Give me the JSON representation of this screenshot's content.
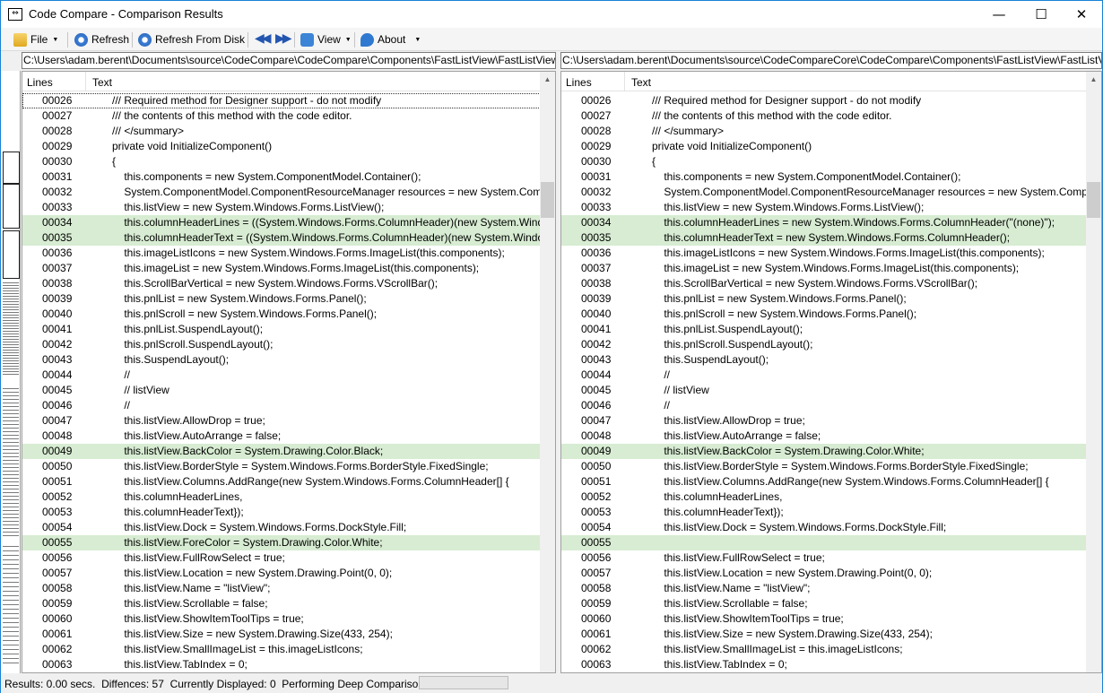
{
  "window": {
    "title": "Code Compare - Comparison Results"
  },
  "toolbar": {
    "file": "File",
    "refresh": "Refresh",
    "refresh_disk": "Refresh From Disk",
    "view": "View",
    "about": "About"
  },
  "left": {
    "path": "C:\\Users\\adam.berent\\Documents\\source\\CodeCompare\\CodeCompare\\Components\\FastListView\\FastListView.Designer.cs",
    "col_lines": "Lines",
    "col_text": "Text",
    "rows": [
      {
        "n": "00026",
        "t": "/// Required method for Designer support - do not modify",
        "d": 0
      },
      {
        "n": "00027",
        "t": "/// the contents of this method with the code editor.",
        "d": 0
      },
      {
        "n": "00028",
        "t": "/// </summary>",
        "d": 0
      },
      {
        "n": "00029",
        "t": "private void InitializeComponent()",
        "d": 0
      },
      {
        "n": "00030",
        "t": "{",
        "d": 0
      },
      {
        "n": "00031",
        "t": "    this.components = new System.ComponentModel.Container();",
        "d": 0
      },
      {
        "n": "00032",
        "t": "    System.ComponentModel.ComponentResourceManager resources = new System.ComponentModel.ComponentResourceManager(typeof(FastListView));",
        "d": 0
      },
      {
        "n": "00033",
        "t": "    this.listView = new System.Windows.Forms.ListView();",
        "d": 0
      },
      {
        "n": "00034",
        "t": "    this.columnHeaderLines = ((System.Windows.Forms.ColumnHeader)(new System.Windows.Forms.ColumnHeader()));",
        "d": 1
      },
      {
        "n": "00035",
        "t": "    this.columnHeaderText = ((System.Windows.Forms.ColumnHeader)(new System.Windows.Forms.ColumnHeader()));",
        "d": 1
      },
      {
        "n": "00036",
        "t": "    this.imageListIcons = new System.Windows.Forms.ImageList(this.components);",
        "d": 0
      },
      {
        "n": "00037",
        "t": "    this.imageList = new System.Windows.Forms.ImageList(this.components);",
        "d": 0
      },
      {
        "n": "00038",
        "t": "    this.ScrollBarVertical = new System.Windows.Forms.VScrollBar();",
        "d": 0
      },
      {
        "n": "00039",
        "t": "    this.pnlList = new System.Windows.Forms.Panel();",
        "d": 0
      },
      {
        "n": "00040",
        "t": "    this.pnlScroll = new System.Windows.Forms.Panel();",
        "d": 0
      },
      {
        "n": "00041",
        "t": "    this.pnlList.SuspendLayout();",
        "d": 0
      },
      {
        "n": "00042",
        "t": "    this.pnlScroll.SuspendLayout();",
        "d": 0
      },
      {
        "n": "00043",
        "t": "    this.SuspendLayout();",
        "d": 0
      },
      {
        "n": "00044",
        "t": "    //",
        "d": 0
      },
      {
        "n": "00045",
        "t": "    // listView",
        "d": 0
      },
      {
        "n": "00046",
        "t": "    //",
        "d": 0
      },
      {
        "n": "00047",
        "t": "    this.listView.AllowDrop = true;",
        "d": 0
      },
      {
        "n": "00048",
        "t": "    this.listView.AutoArrange = false;",
        "d": 0
      },
      {
        "n": "00049",
        "t": "    this.listView.BackColor = System.Drawing.Color.Black;",
        "d": 1
      },
      {
        "n": "00050",
        "t": "    this.listView.BorderStyle = System.Windows.Forms.BorderStyle.FixedSingle;",
        "d": 0
      },
      {
        "n": "00051",
        "t": "    this.listView.Columns.AddRange(new System.Windows.Forms.ColumnHeader[] {",
        "d": 0
      },
      {
        "n": "00052",
        "t": "    this.columnHeaderLines,",
        "d": 0
      },
      {
        "n": "00053",
        "t": "    this.columnHeaderText});",
        "d": 0
      },
      {
        "n": "00054",
        "t": "    this.listView.Dock = System.Windows.Forms.DockStyle.Fill;",
        "d": 0
      },
      {
        "n": "00055",
        "t": "    this.listView.ForeColor = System.Drawing.Color.White;",
        "d": 1
      },
      {
        "n": "00056",
        "t": "    this.listView.FullRowSelect = true;",
        "d": 0
      },
      {
        "n": "00057",
        "t": "    this.listView.Location = new System.Drawing.Point(0, 0);",
        "d": 0
      },
      {
        "n": "00058",
        "t": "    this.listView.Name = \"listView\";",
        "d": 0
      },
      {
        "n": "00059",
        "t": "    this.listView.Scrollable = false;",
        "d": 0
      },
      {
        "n": "00060",
        "t": "    this.listView.ShowItemToolTips = true;",
        "d": 0
      },
      {
        "n": "00061",
        "t": "    this.listView.Size = new System.Drawing.Size(433, 254);",
        "d": 0
      },
      {
        "n": "00062",
        "t": "    this.listView.SmallImageList = this.imageListIcons;",
        "d": 0
      },
      {
        "n": "00063",
        "t": "    this.listView.TabIndex = 0;",
        "d": 0
      }
    ]
  },
  "right": {
    "path": "C:\\Users\\adam.berent\\Documents\\source\\CodeCompareCore\\CodeCompare\\Components\\FastListView\\FastListView.Designer.cs",
    "col_lines": "Lines",
    "col_text": "Text",
    "rows": [
      {
        "n": "00026",
        "t": "/// Required method for Designer support - do not modify",
        "d": 0
      },
      {
        "n": "00027",
        "t": "/// the contents of this method with the code editor.",
        "d": 0
      },
      {
        "n": "00028",
        "t": "/// </summary>",
        "d": 0
      },
      {
        "n": "00029",
        "t": "private void InitializeComponent()",
        "d": 0
      },
      {
        "n": "00030",
        "t": "{",
        "d": 0
      },
      {
        "n": "00031",
        "t": "    this.components = new System.ComponentModel.Container();",
        "d": 0
      },
      {
        "n": "00032",
        "t": "    System.ComponentModel.ComponentResourceManager resources = new System.ComponentModel.ComponentResourceManager(typeof(FastListView));",
        "d": 0
      },
      {
        "n": "00033",
        "t": "    this.listView = new System.Windows.Forms.ListView();",
        "d": 0
      },
      {
        "n": "00034",
        "t": "    this.columnHeaderLines = new System.Windows.Forms.ColumnHeader(\"(none)\");",
        "d": 1
      },
      {
        "n": "00035",
        "t": "    this.columnHeaderText = new System.Windows.Forms.ColumnHeader();",
        "d": 1
      },
      {
        "n": "00036",
        "t": "    this.imageListIcons = new System.Windows.Forms.ImageList(this.components);",
        "d": 0
      },
      {
        "n": "00037",
        "t": "    this.imageList = new System.Windows.Forms.ImageList(this.components);",
        "d": 0
      },
      {
        "n": "00038",
        "t": "    this.ScrollBarVertical = new System.Windows.Forms.VScrollBar();",
        "d": 0
      },
      {
        "n": "00039",
        "t": "    this.pnlList = new System.Windows.Forms.Panel();",
        "d": 0
      },
      {
        "n": "00040",
        "t": "    this.pnlScroll = new System.Windows.Forms.Panel();",
        "d": 0
      },
      {
        "n": "00041",
        "t": "    this.pnlList.SuspendLayout();",
        "d": 0
      },
      {
        "n": "00042",
        "t": "    this.pnlScroll.SuspendLayout();",
        "d": 0
      },
      {
        "n": "00043",
        "t": "    this.SuspendLayout();",
        "d": 0
      },
      {
        "n": "00044",
        "t": "    //",
        "d": 0
      },
      {
        "n": "00045",
        "t": "    // listView",
        "d": 0
      },
      {
        "n": "00046",
        "t": "    //",
        "d": 0
      },
      {
        "n": "00047",
        "t": "    this.listView.AllowDrop = true;",
        "d": 0
      },
      {
        "n": "00048",
        "t": "    this.listView.AutoArrange = false;",
        "d": 0
      },
      {
        "n": "00049",
        "t": "    this.listView.BackColor = System.Drawing.Color.White;",
        "d": 1
      },
      {
        "n": "00050",
        "t": "    this.listView.BorderStyle = System.Windows.Forms.BorderStyle.FixedSingle;",
        "d": 0
      },
      {
        "n": "00051",
        "t": "    this.listView.Columns.AddRange(new System.Windows.Forms.ColumnHeader[] {",
        "d": 0
      },
      {
        "n": "00052",
        "t": "    this.columnHeaderLines,",
        "d": 0
      },
      {
        "n": "00053",
        "t": "    this.columnHeaderText});",
        "d": 0
      },
      {
        "n": "00054",
        "t": "    this.listView.Dock = System.Windows.Forms.DockStyle.Fill;",
        "d": 0
      },
      {
        "n": "00055",
        "t": "",
        "d": 1
      },
      {
        "n": "00056",
        "t": "    this.listView.FullRowSelect = true;",
        "d": 0
      },
      {
        "n": "00057",
        "t": "    this.listView.Location = new System.Drawing.Point(0, 0);",
        "d": 0
      },
      {
        "n": "00058",
        "t": "    this.listView.Name = \"listView\";",
        "d": 0
      },
      {
        "n": "00059",
        "t": "    this.listView.Scrollable = false;",
        "d": 0
      },
      {
        "n": "00060",
        "t": "    this.listView.ShowItemToolTips = true;",
        "d": 0
      },
      {
        "n": "00061",
        "t": "    this.listView.Size = new System.Drawing.Size(433, 254);",
        "d": 0
      },
      {
        "n": "00062",
        "t": "    this.listView.SmallImageList = this.imageListIcons;",
        "d": 0
      },
      {
        "n": "00063",
        "t": "    this.listView.TabIndex = 0;",
        "d": 0
      }
    ]
  },
  "status": {
    "results": "Results: 0.00 secs.",
    "differences": "Diffences: 57",
    "displayed": "Currently Displayed: 0",
    "deep": "Performing Deep Comparison:",
    "progress": 0
  },
  "colors": {
    "diff_row": "#d7ecd2",
    "accent": "#1883d7"
  }
}
